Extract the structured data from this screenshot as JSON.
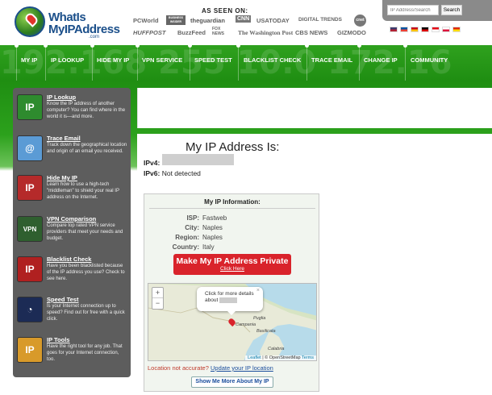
{
  "logo": {
    "line1": "WhatIs",
    "line2": "MyIPAddress",
    "suffix": ".com"
  },
  "as_seen_on": "AS SEEN ON:",
  "media": [
    "PCWorld",
    "BUSINESS INSIDER",
    "theguardian",
    "CNN",
    "USATODAY",
    "DIGITAL TRENDS",
    "cnet",
    "HUFFPOST",
    "BuzzFeed",
    "FOX NEWS",
    "The Washington Post",
    "CBS NEWS",
    "GIZMODO"
  ],
  "search": {
    "placeholder": "IP Address/Search",
    "button": "Search"
  },
  "flags": [
    {
      "name": "us-flag",
      "color": "#3c3b6e",
      "stripe": "#b22234"
    },
    {
      "name": "fr-flag",
      "color": "#0055a4",
      "stripe": "#ef4135"
    },
    {
      "name": "es-flag",
      "color": "#c60b1e",
      "stripe": "#ffc400"
    },
    {
      "name": "de-flag",
      "color": "#000000",
      "stripe": "#dd0000"
    },
    {
      "name": "tr-flag",
      "color": "#e30a17",
      "stripe": "#ffffff"
    },
    {
      "name": "pl-flag",
      "color": "#ffffff",
      "stripe": "#dc143c"
    },
    {
      "name": "cn-flag",
      "color": "#de2910",
      "stripe": "#ffde00"
    }
  ],
  "nav": [
    "MY IP",
    "IP LOOKUP",
    "HIDE MY IP",
    "VPN SERVICE",
    "SPEED TEST",
    "BLACKLIST CHECK",
    "TRACE EMAIL",
    "CHANGE IP",
    "COMMUNITY"
  ],
  "sidebar": [
    {
      "title": "IP Lookup",
      "desc": "Know the IP address of another computer? You can find where in the world it is—and more.",
      "icon": "ip-lookup-icon",
      "bg": "#2e8b2e"
    },
    {
      "title": "Trace Email",
      "desc": "Track down the geographical location and origin of an email you received.",
      "icon": "trace-email-icon",
      "bg": "#5b9bd5"
    },
    {
      "title": "Hide My IP",
      "desc": "Learn how to use a high-tech \"middleman\" to shield your real IP address on the Internet.",
      "icon": "hide-ip-icon",
      "bg": "#b52a2a"
    },
    {
      "title": "VPN Comparison",
      "desc": "Compare top rated VPN service providers that meet your needs and budget.",
      "icon": "vpn-icon",
      "bg": "#2f5f2f"
    },
    {
      "title": "Blacklist Check",
      "desc": "Have you been blacklisted because of the IP address you use? Check to see here.",
      "icon": "blacklist-icon",
      "bg": "#b02020"
    },
    {
      "title": "Speed Test",
      "desc": "Is your Internet connection up to speed? Find out for free with a quick click.",
      "icon": "speed-test-icon",
      "bg": "#1c2b55"
    },
    {
      "title": "IP Tools",
      "desc": "Have the right tool for any job. That goes for your Internet connection, too.",
      "icon": "ip-tools-icon",
      "bg": "#d89a2a"
    }
  ],
  "main": {
    "heading": "My IP Address Is:",
    "ipv4_label": "IPv4:",
    "ipv6_label": "IPv6:",
    "ipv6_value": "Not detected"
  },
  "info": {
    "title": "My IP Information:",
    "rows": [
      {
        "label": "ISP:",
        "value": "Fastweb"
      },
      {
        "label": "City:",
        "value": "Naples"
      },
      {
        "label": "Region:",
        "value": "Naples"
      },
      {
        "label": "Country:",
        "value": "Italy"
      }
    ],
    "private_button": "Make My IP Address Private",
    "private_sub": "Click Here"
  },
  "map": {
    "zoom_in": "+",
    "zoom_out": "−",
    "popup_text": "Click for more details about",
    "popup_close": "×",
    "labels": [
      "Puglia",
      "Campania",
      "Basilicata",
      "Calabria"
    ],
    "attrib_leaflet": "Leaflet",
    "attrib_osm": "| © OpenStreetMap",
    "attrib_terms": "Terms"
  },
  "location_note": "Location not accurate?",
  "update_link": "Update your IP location",
  "more_button": "Show Me More About My IP"
}
